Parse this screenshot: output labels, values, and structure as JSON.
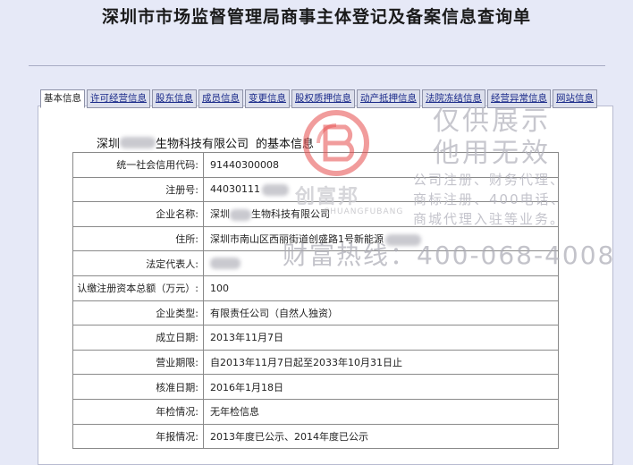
{
  "page_title": "深圳市市场监督管理局商事主体登记及备案信息查询单",
  "tabs": [
    {
      "label": "基本信息"
    },
    {
      "label": "许可经营信息"
    },
    {
      "label": "股东信息"
    },
    {
      "label": "成员信息"
    },
    {
      "label": "变更信息"
    },
    {
      "label": "股权质押信息"
    },
    {
      "label": "动产抵押信息"
    },
    {
      "label": "法院冻结信息"
    },
    {
      "label": "经营异常信息"
    },
    {
      "label": "网站信息"
    }
  ],
  "company": {
    "prefix": "深圳",
    "suffix": "生物科技有限公司",
    "heading_suffix": "的基本信息"
  },
  "rows": [
    {
      "label": "统一社会信用代码:",
      "value": "91440300008"
    },
    {
      "label": "注册号:",
      "value": "44030111"
    },
    {
      "label": "企业名称:",
      "value": "深圳",
      "value2": "生物科技有限公司"
    },
    {
      "label": "住所:",
      "value": "深圳市南山区西丽街道创盛路1号新能源"
    },
    {
      "label": "法定代表人:",
      "value": ""
    },
    {
      "label": "认缴注册资本总额（万元）:",
      "value": "100"
    },
    {
      "label": "企业类型:",
      "value": "有限责任公司（自然人独资）"
    },
    {
      "label": "成立日期:",
      "value": "2013年11月7日"
    },
    {
      "label": "营业期限:",
      "value": "自2013年11月7日起至2033年10月31日止"
    },
    {
      "label": "核准日期:",
      "value": "2016年1月18日"
    },
    {
      "label": "年检情况:",
      "value": "无年检信息"
    },
    {
      "label": "年报情况:",
      "value": "2013年度已公示、2014年度已公示"
    }
  ],
  "watermark": {
    "brand_cn": "创富邦",
    "brand_en": "CHUANGFUBANG",
    "line1": "仅供展示",
    "line2": "他用无效",
    "service1": "公司注册、财务代理、",
    "service2": "商标注册、400电话、",
    "service3": "商城代理入驻等业务。",
    "hotline": "财富热线：400-068-4008"
  },
  "colors": {
    "background": "#e6e9f7",
    "tab_link": "#1a2a8a",
    "logo_red": "#e64b4b"
  }
}
